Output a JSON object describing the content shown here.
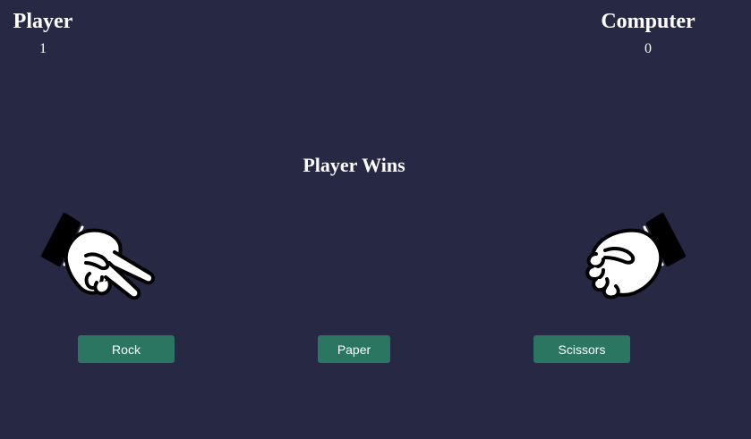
{
  "scoreboard": {
    "player": {
      "title": "Player",
      "score": "1"
    },
    "computer": {
      "title": "Computer",
      "score": "0"
    }
  },
  "result": "Player Wins",
  "hands": {
    "player": {
      "icon": "scissors-hand-icon"
    },
    "computer": {
      "icon": "rock-fist-icon"
    }
  },
  "choices": {
    "rock": "Rock",
    "paper": "Paper",
    "scissors": "Scissors"
  },
  "colors": {
    "background": "#262844",
    "button": "#2b7660",
    "text": "#ffffff"
  }
}
